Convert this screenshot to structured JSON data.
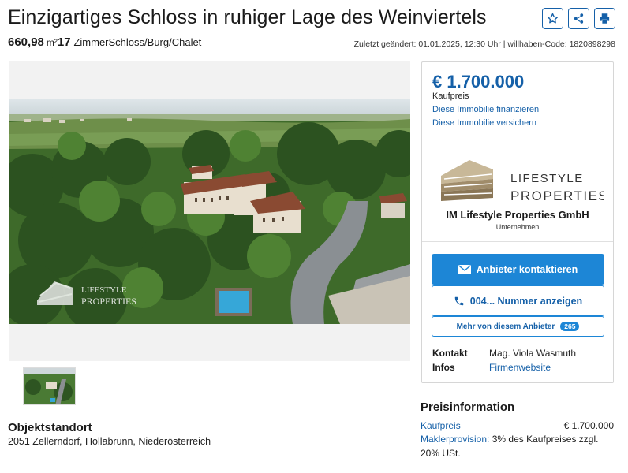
{
  "listing": {
    "title": "Einzigartiges Schloss in ruhiger Lage des Weinviertels",
    "area": "660,98",
    "area_unit": "m²",
    "rooms": "17",
    "type": "ZimmerSchloss/Burg/Chalet",
    "meta": "Zuletzt geändert: 01.01.2025, 12:30 Uhr | willhaben-Code: 1820898298"
  },
  "actions": {
    "favorite_icon": "star-icon",
    "share_icon": "share-icon",
    "print_icon": "print-icon"
  },
  "gallery": {
    "watermark_line1": "LIFESTYLE",
    "watermark_line2": "PROPERTIES"
  },
  "location": {
    "heading": "Objektstandort",
    "address": "2051 Zellerndorf, Hollabrunn, Niederösterreich"
  },
  "sidebar": {
    "price": "€ 1.700.000",
    "price_label": "Kaufpreis",
    "finance_link": "Diese Immobilie finanzieren",
    "insure_link": "Diese Immobilie versichern",
    "logo_line1": "LIFESTYLE",
    "logo_line2": "PROPERTIES",
    "company": "IM Lifestyle Properties GmbH",
    "company_type": "Unternehmen",
    "contact_button": "Anbieter kontaktieren",
    "phone_button": "004... Nummer anzeigen",
    "more_button": "Mehr von diesem Anbieter",
    "more_count": "265",
    "contact_label": "Kontakt",
    "contact_value": "Mag. Viola Wasmuth",
    "infos_label": "Infos",
    "infos_value": "Firmenwebsite"
  },
  "price_info": {
    "heading": "Preisinformation",
    "kaufpreis_label": "Kaufpreis",
    "kaufpreis_value": "€ 1.700.000",
    "provision_label": "Maklerprovision:",
    "provision_value": "3% des Kaufpreises zzgl.",
    "provision_value2": "20% USt."
  },
  "colors": {
    "accent": "#1560a8",
    "button": "#1d86d6"
  }
}
